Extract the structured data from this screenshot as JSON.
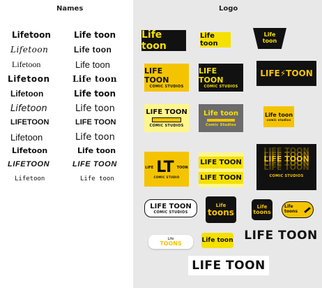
{
  "headers": {
    "names": "Names",
    "logo": "Logo"
  },
  "names": {
    "column_a": [
      "Lifetoon",
      "Lifetoon",
      "Lifetoon",
      "Lifetoon",
      "Lifetoon",
      "Lifetoon",
      "LIFETOON",
      "Lifetoon",
      "Lifetoon",
      "LIFETOON",
      "Lifetoon"
    ],
    "column_b": [
      "Life toon",
      "Life toon",
      "Life toon",
      "Life toon",
      "Life toon",
      "Life toon",
      "LIFE TOON",
      "Life toon",
      "Life toon",
      "LIFE TOON",
      "Life toon"
    ]
  },
  "logos": {
    "l1": "Life toon",
    "l2": "Life toon",
    "l3": "Life toon",
    "l4_title": "LIFE TOON",
    "l4_sub": "COMIC STUDIOS",
    "l5_title": "LIFE TOON",
    "l5_sub": "COMIC STUDIOS",
    "l6": "LIFE⚡TOON",
    "l7_title": "LIFE TOON",
    "l7_sub": "COMIC STUDIOS",
    "l8_title": "Life toon",
    "l8_sub": "Comic Studios",
    "l9_title": "Life toon",
    "l9_sub": "comic studios",
    "l10_mono": "LT",
    "l10_left": "LIFE",
    "l10_right": "TOON",
    "l10_sub": "COMIC STUDIO",
    "l11a": "LIFE TOON",
    "l11b": "LIFE TOON",
    "l12_title": "LIFE TOON",
    "l12_sub": "COMIC STUDIOS",
    "l13_title": "LIFE TOON",
    "l13_sub": "COMIC STUDIOS",
    "l14_a": "Life",
    "l14_b": "toons",
    "l15_a": "Life",
    "l15_b": "toons",
    "l16": "Life toons",
    "l17_a": "Life",
    "l17_b": "TOONS",
    "l18": "Life toon",
    "l19": "LIFE TOON",
    "l20": "LIFE TOON"
  },
  "colors": {
    "yellow": "#f5e000",
    "gold": "#f5c400",
    "black": "#111111",
    "panel": "#e8e8e8",
    "gray": "#6b6b6b",
    "paleyellow": "#fff68a"
  }
}
